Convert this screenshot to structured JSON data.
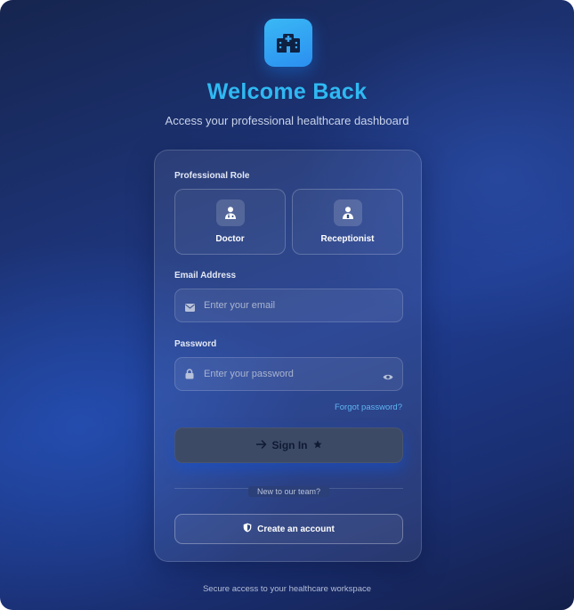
{
  "header": {
    "logo_icon": "hospital-icon",
    "title": "Welcome Back",
    "subtitle": "Access your professional healthcare dashboard"
  },
  "form": {
    "role_label": "Professional Role",
    "roles": [
      {
        "label": "Doctor",
        "icon": "doctor-icon"
      },
      {
        "label": "Receptionist",
        "icon": "receptionist-icon"
      }
    ],
    "email": {
      "label": "Email Address",
      "placeholder": "Enter your email",
      "value": "",
      "icon": "envelope-icon"
    },
    "password": {
      "label": "Password",
      "placeholder": "Enter your password",
      "value": "",
      "icon": "lock-icon",
      "toggle_icon": "eye-icon"
    },
    "forgot_label": "Forgot password?",
    "signin_label": "Sign In",
    "divider_text": "New to our team?",
    "create_label": "Create an account"
  },
  "footer": {
    "text": "Secure access to your healthcare workspace"
  },
  "colors": {
    "accent": "#2fb9f2",
    "link": "#5fb4f5",
    "signin_bg": "#3d4a66"
  }
}
